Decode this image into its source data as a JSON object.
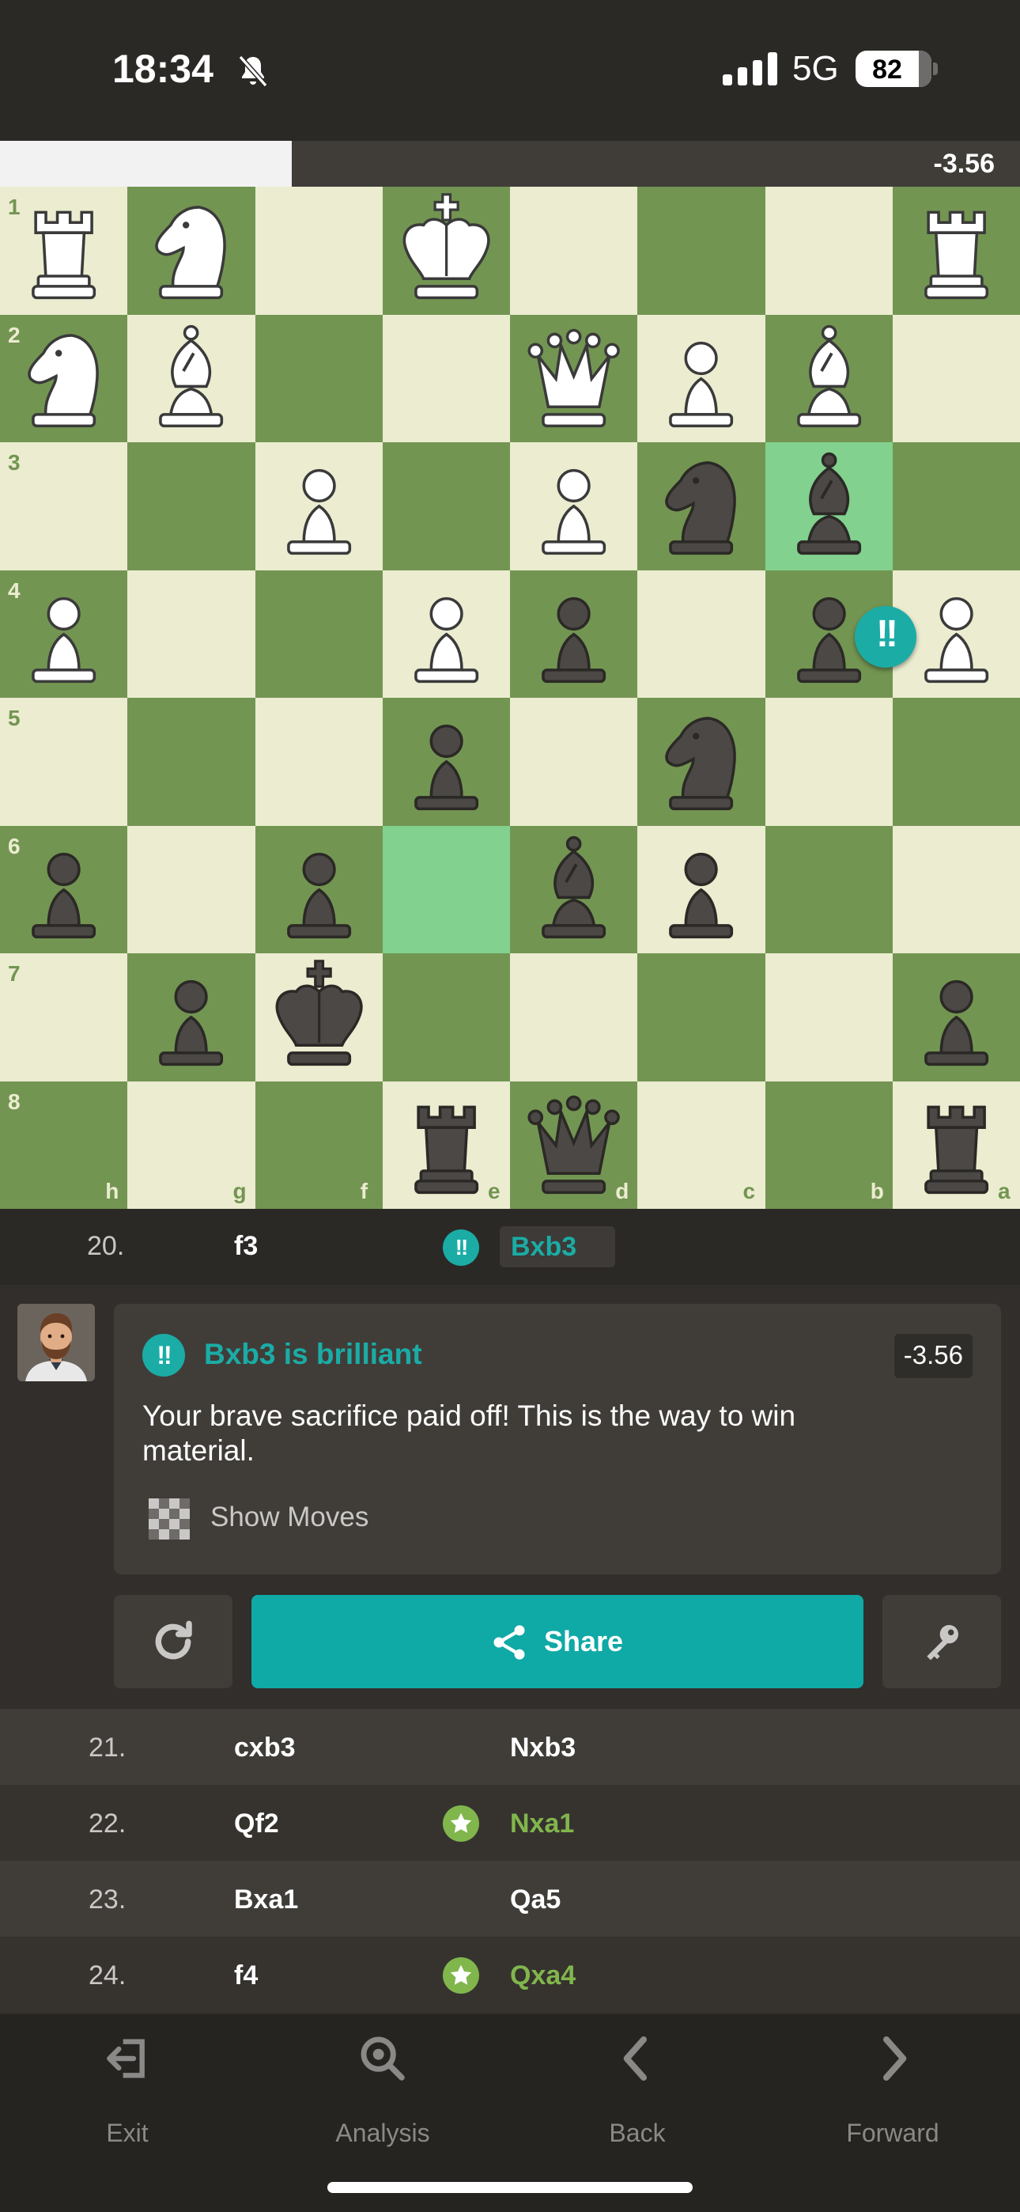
{
  "status_bar": {
    "time": "18:34",
    "network": "5G",
    "battery": "82",
    "battery_level": 82
  },
  "eval_bar": {
    "score": "-3.56",
    "white_fraction": 0.286
  },
  "board": {
    "flipped": true,
    "rank_labels": [
      "1",
      "2",
      "3",
      "4",
      "5",
      "6",
      "7",
      "8"
    ],
    "file_labels": [
      "h",
      "g",
      "f",
      "e",
      "d",
      "c",
      "b",
      "a"
    ],
    "highlight_squares": [
      "e6",
      "b3"
    ],
    "brilliant_square": "b3",
    "pieces": [
      {
        "square": "h1",
        "piece": "wR"
      },
      {
        "square": "g1",
        "piece": "wN"
      },
      {
        "square": "e1",
        "piece": "wK"
      },
      {
        "square": "a1",
        "piece": "wR"
      },
      {
        "square": "h2",
        "piece": "wN"
      },
      {
        "square": "g2",
        "piece": "wB"
      },
      {
        "square": "d2",
        "piece": "wQ"
      },
      {
        "square": "c2",
        "piece": "wP"
      },
      {
        "square": "b2",
        "piece": "wB"
      },
      {
        "square": "f3",
        "piece": "wP"
      },
      {
        "square": "d3",
        "piece": "wP"
      },
      {
        "square": "c3",
        "piece": "bN"
      },
      {
        "square": "b3",
        "piece": "bB"
      },
      {
        "square": "h4",
        "piece": "wP"
      },
      {
        "square": "e4",
        "piece": "wP"
      },
      {
        "square": "d4",
        "piece": "bP"
      },
      {
        "square": "b4",
        "piece": "bP"
      },
      {
        "square": "a4",
        "piece": "wP"
      },
      {
        "square": "e5",
        "piece": "bP"
      },
      {
        "square": "c5",
        "piece": "bN"
      },
      {
        "square": "h6",
        "piece": "bP"
      },
      {
        "square": "f6",
        "piece": "bP"
      },
      {
        "square": "d6",
        "piece": "bB"
      },
      {
        "square": "c6",
        "piece": "bP"
      },
      {
        "square": "g7",
        "piece": "bP"
      },
      {
        "square": "f7",
        "piece": "bK"
      },
      {
        "square": "a7",
        "piece": "bP"
      },
      {
        "square": "e8",
        "piece": "bR"
      },
      {
        "square": "d8",
        "piece": "bQ"
      },
      {
        "square": "a8",
        "piece": "bR"
      }
    ]
  },
  "current_move": {
    "number": "20.",
    "white": "f3",
    "black": "Bxb3",
    "badge": "!!"
  },
  "coach": {
    "badge": "!!",
    "title": "Bxb3 is brilliant",
    "eval": "-3.56",
    "message": "Your brave sacrifice paid off! This is the way to win material.",
    "show_moves": "Show Moves"
  },
  "actions": {
    "share_label": "Share"
  },
  "moves": [
    {
      "number": "21.",
      "white": "cxb3",
      "black": "Nxb3",
      "best": false
    },
    {
      "number": "22.",
      "white": "Qf2",
      "black": "Nxa1",
      "best": true
    },
    {
      "number": "23.",
      "white": "Bxa1",
      "black": "Qa5",
      "best": false
    },
    {
      "number": "24.",
      "white": "f4",
      "black": "Qxa4",
      "best": true
    }
  ],
  "nav": [
    {
      "label": "Exit",
      "icon": "exit-icon"
    },
    {
      "label": "Analysis",
      "icon": "analysis-icon"
    },
    {
      "label": "Back",
      "icon": "chevron-left-icon"
    },
    {
      "label": "Forward",
      "icon": "chevron-right-icon"
    }
  ],
  "colors": {
    "light": "#ebecd0",
    "dark": "#739552",
    "highlight": "#82d18f",
    "brilliant": "#1baca6",
    "best": "#81b64c",
    "share": "#0fa9a6"
  }
}
